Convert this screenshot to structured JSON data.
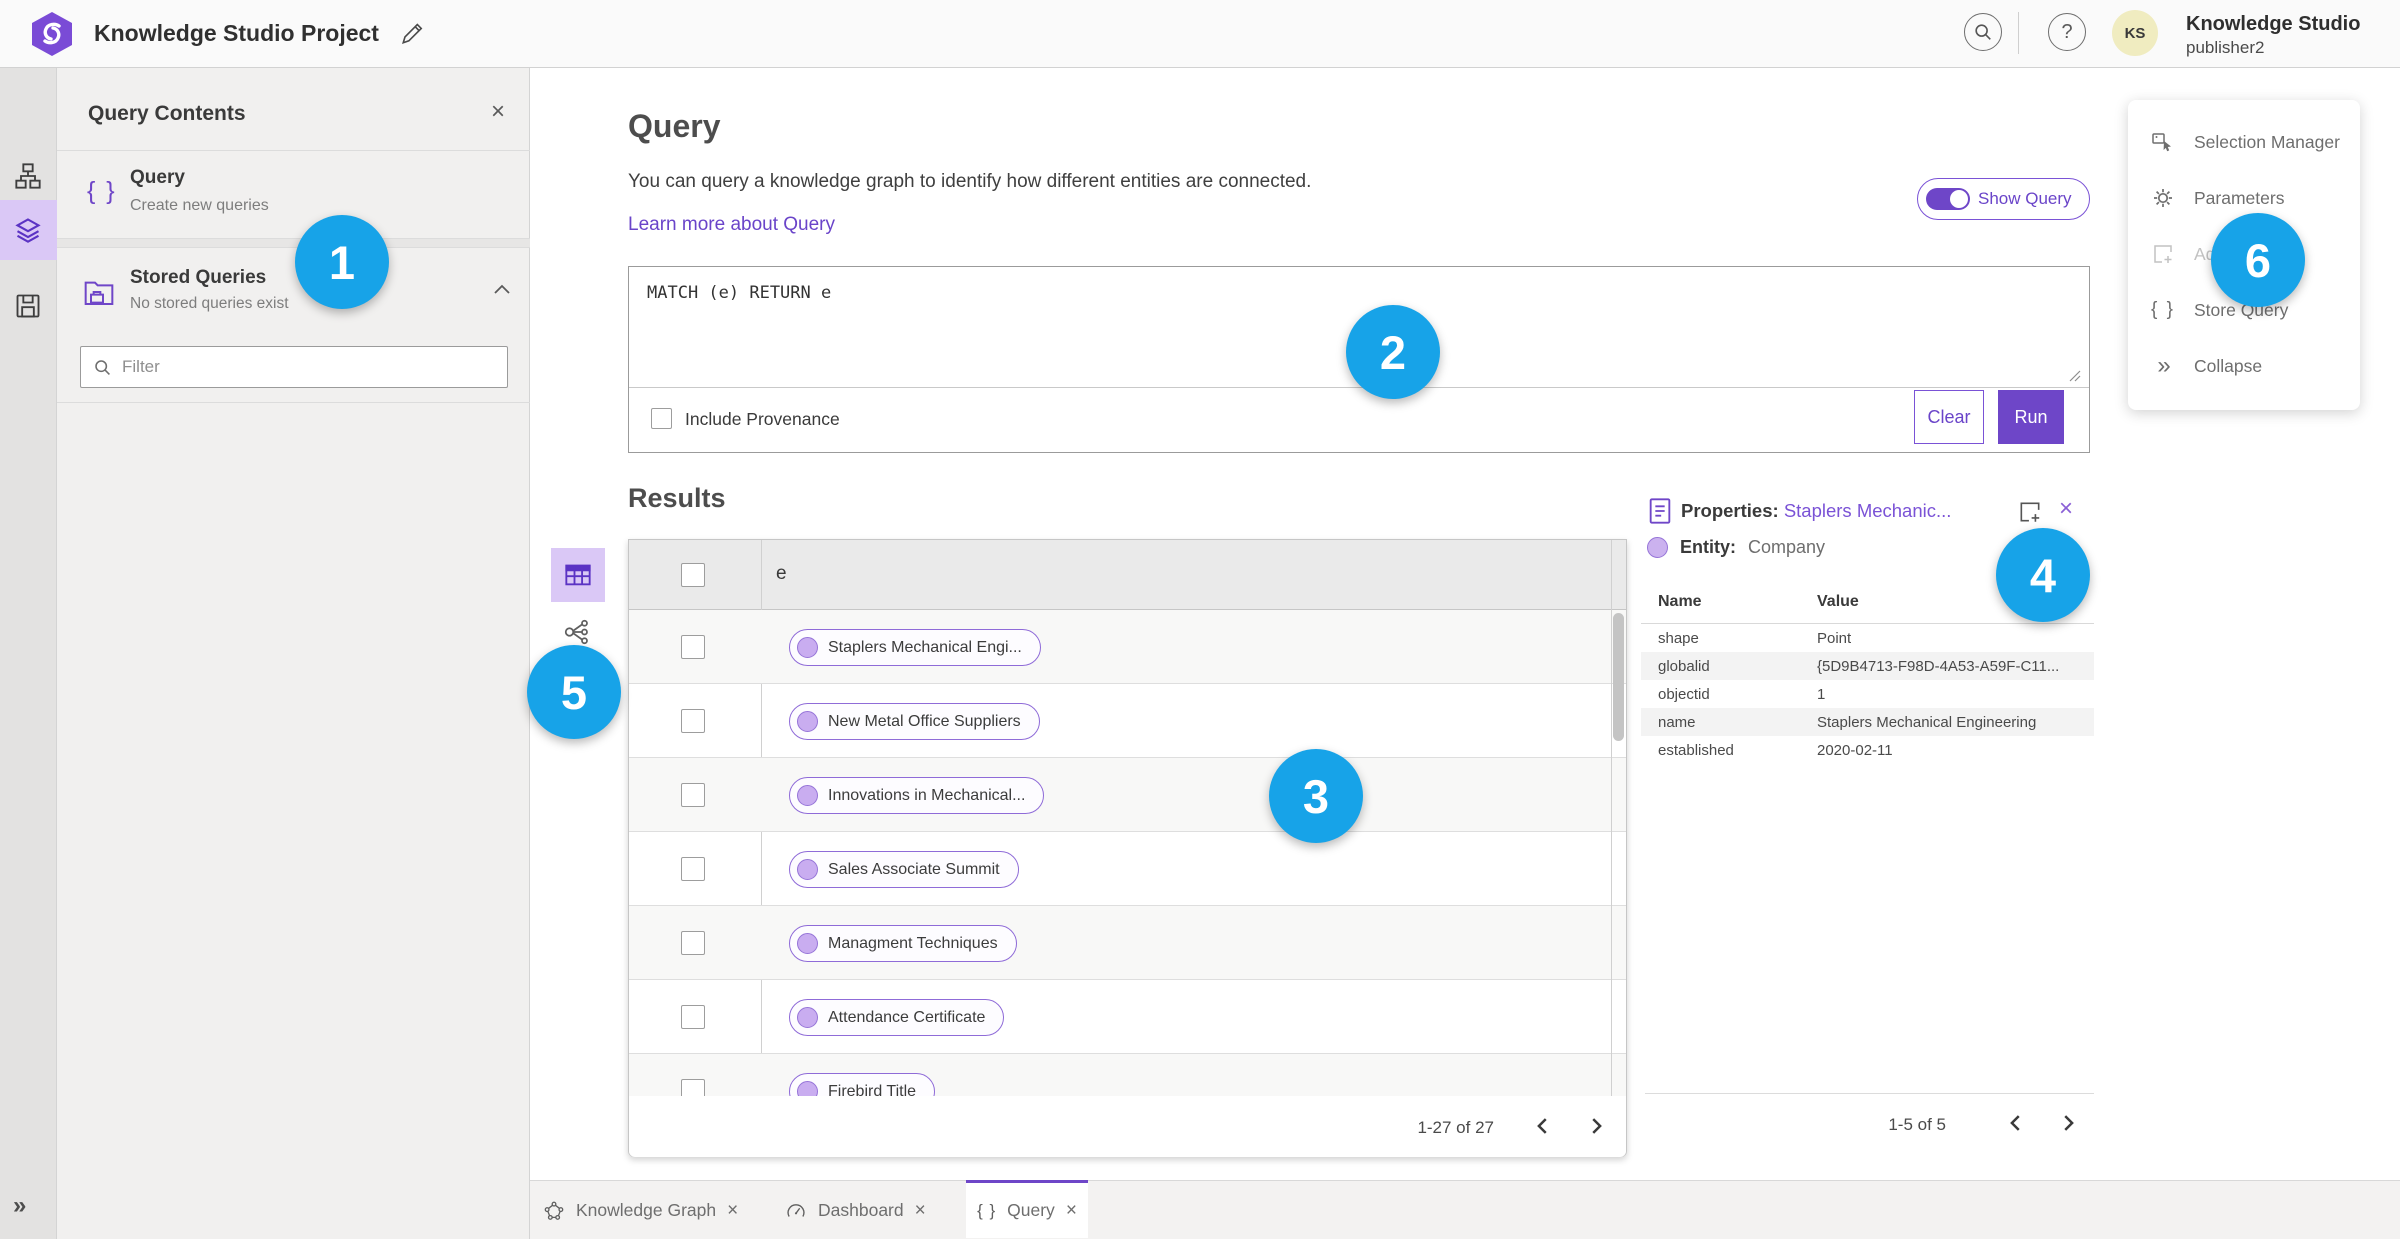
{
  "header": {
    "title": "Knowledge Studio Project",
    "account_name": "Knowledge Studio",
    "account_role": "publisher2",
    "avatar_initials": "KS",
    "help_glyph": "?"
  },
  "icons": {
    "close": "×",
    "braces": "{ }",
    "collapse_chevrons": "»"
  },
  "contents_panel": {
    "title": "Query Contents",
    "query_item": {
      "label": "Query",
      "description": "Create new queries"
    },
    "stored_item": {
      "label": "Stored Queries",
      "description": "No stored queries exist"
    },
    "filter_placeholder": "Filter"
  },
  "query_section": {
    "title": "Query",
    "description": "You can query a knowledge graph to identify how different entities are connected.",
    "learn_more": "Learn more about Query",
    "show_query_label": "Show Query",
    "query_text": "MATCH (e) RETURN e",
    "include_provenance_label": "Include Provenance",
    "clear_label": "Clear",
    "run_label": "Run"
  },
  "results": {
    "title": "Results",
    "column_header": "e",
    "rows": [
      {
        "label": "Staplers Mechanical Engi..."
      },
      {
        "label": "New Metal Office Suppliers"
      },
      {
        "label": "Innovations in Mechanical..."
      },
      {
        "label": "Sales Associate Summit"
      },
      {
        "label": "Managment Techniques"
      },
      {
        "label": "Attendance Certificate"
      },
      {
        "label": "Firebird Title"
      }
    ],
    "pagination": {
      "range": "1-27 of 27"
    }
  },
  "properties_panel": {
    "title_prefix": "Properties:",
    "title_entity": "Staplers Mechanic...",
    "entity_prefix": "Entity:",
    "entity_type": "Company",
    "columns": {
      "name": "Name",
      "value": "Value"
    },
    "rows": [
      {
        "name": "shape",
        "value": "Point"
      },
      {
        "name": "globalid",
        "value": "{5D9B4713-F98D-4A53-A59F-C11..."
      },
      {
        "name": "objectid",
        "value": "1"
      },
      {
        "name": "name",
        "value": "Staplers Mechanical Engineering"
      },
      {
        "name": "established",
        "value": "2020-02-11"
      }
    ],
    "pagination": {
      "range": "1-5 of 5"
    }
  },
  "tools_menu": {
    "items": [
      {
        "label": "Selection Manager"
      },
      {
        "label": "Parameters"
      },
      {
        "label": "Add"
      },
      {
        "label": "Store Query"
      },
      {
        "label": "Collapse"
      }
    ]
  },
  "tabs": [
    {
      "label": "Knowledge Graph"
    },
    {
      "label": "Dashboard"
    },
    {
      "label": "Query"
    }
  ],
  "annotations": [
    {
      "label": "1"
    },
    {
      "label": "2"
    },
    {
      "label": "3"
    },
    {
      "label": "4"
    },
    {
      "label": "5"
    },
    {
      "label": "6"
    }
  ],
  "colors": {
    "accent_purple": "#6e46c8",
    "selected_lavender": "#dac8f6",
    "callout_blue": "#17a3e8",
    "avatar_bg": "#f0ecc0"
  }
}
